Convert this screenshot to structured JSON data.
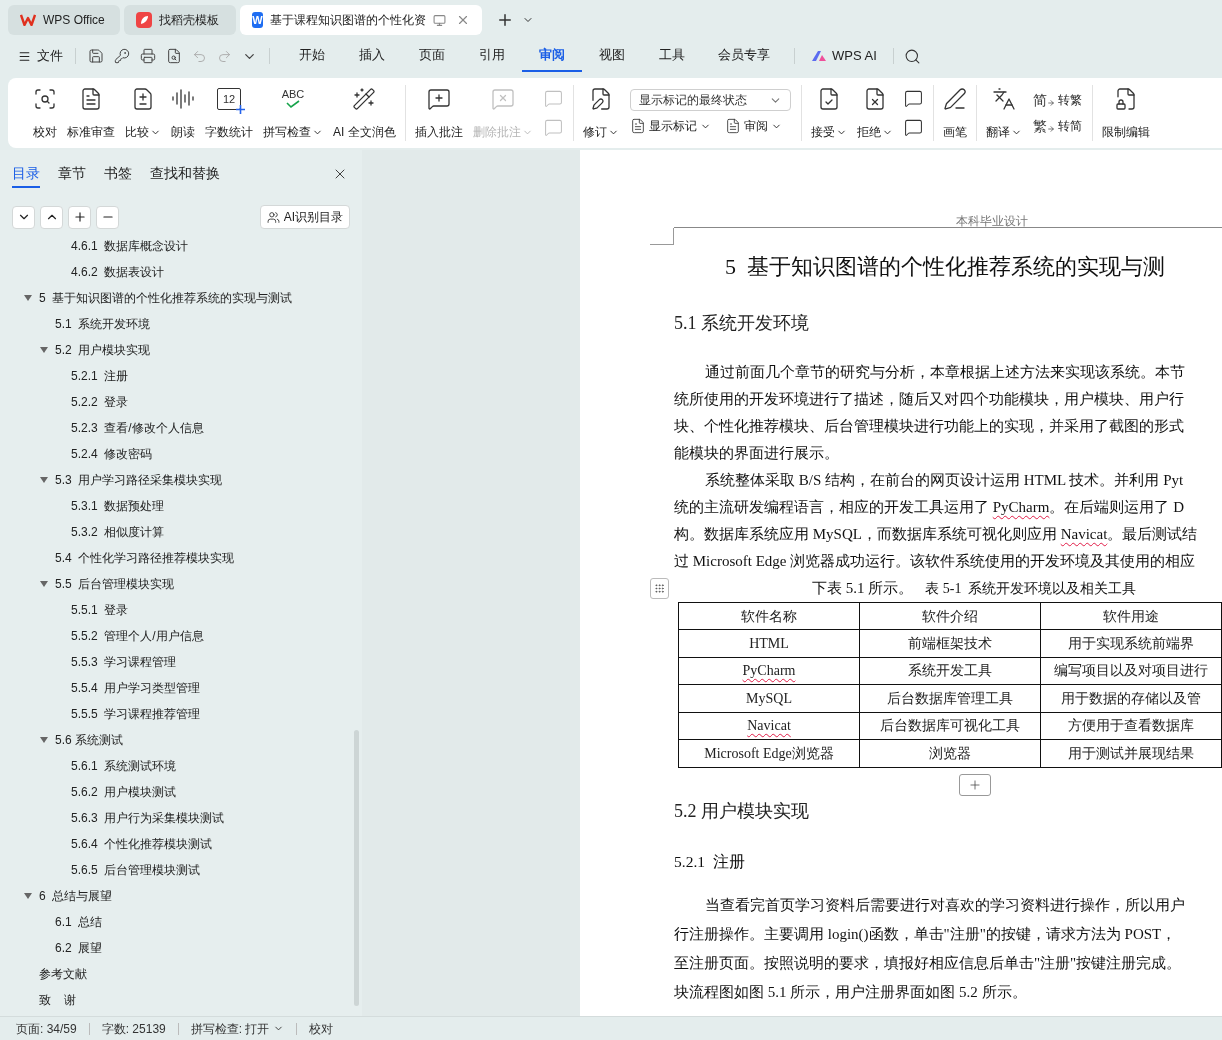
{
  "tabs": [
    {
      "label": "WPS Office",
      "selected": false
    },
    {
      "label": "找稻壳模板",
      "selected": false
    },
    {
      "label": "基于课程知识图谱的个性化资",
      "selected": true,
      "icon_letter": "W"
    }
  ],
  "menu": {
    "file": "文件",
    "tabs": [
      {
        "label": "开始",
        "selected": false
      },
      {
        "label": "插入",
        "selected": false
      },
      {
        "label": "页面",
        "selected": false
      },
      {
        "label": "引用",
        "selected": false
      },
      {
        "label": "审阅",
        "selected": true
      },
      {
        "label": "视图",
        "selected": false
      },
      {
        "label": "工具",
        "selected": false
      },
      {
        "label": "会员专享",
        "selected": false
      }
    ],
    "ai": "WPS AI"
  },
  "ribbon": {
    "groups": [
      {
        "items": [
          {
            "kind": "large",
            "label": "校对",
            "dropdown": false,
            "disabled": false
          },
          {
            "kind": "large",
            "label": "标准审查",
            "dropdown": false,
            "disabled": false
          },
          {
            "kind": "large",
            "label": "比较",
            "dropdown": true,
            "disabled": false
          },
          {
            "kind": "large",
            "label": "朗读",
            "dropdown": false,
            "disabled": false
          },
          {
            "kind": "large",
            "label": "字数统计",
            "dropdown": false,
            "disabled": false,
            "glyph": "12"
          },
          {
            "kind": "large",
            "label": "拼写检查",
            "dropdown": true,
            "disabled": false,
            "glyph": "ABC"
          },
          {
            "kind": "large",
            "label": "AI 全文润色",
            "dropdown": false,
            "disabled": false
          }
        ]
      },
      {
        "items": [
          {
            "kind": "large",
            "label": "插入批注",
            "dropdown": false,
            "disabled": false
          },
          {
            "kind": "large",
            "label": "删除批注",
            "dropdown": true,
            "disabled": true
          },
          {
            "kind": "stack",
            "rows": [
              [
                {
                  "kind": "icon",
                  "disabled": true
                }
              ],
              [
                {
                  "kind": "icon",
                  "disabled": true
                }
              ]
            ]
          }
        ]
      },
      {
        "items": [
          {
            "kind": "large",
            "label": "修订",
            "dropdown": true,
            "disabled": false
          },
          {
            "kind": "stack",
            "rows": [
              [
                {
                  "kind": "select",
                  "value": "显示标记的最终状态"
                }
              ],
              [
                {
                  "kind": "small",
                  "label": "显示标记",
                  "dropdown": true
                },
                {
                  "kind": "small",
                  "label": "审阅",
                  "dropdown": true
                }
              ]
            ]
          }
        ]
      },
      {
        "items": [
          {
            "kind": "large",
            "label": "接受",
            "dropdown": true,
            "disabled": false
          },
          {
            "kind": "large",
            "label": "拒绝",
            "dropdown": true,
            "disabled": false
          },
          {
            "kind": "stack",
            "rows": [
              [
                {
                  "kind": "icon",
                  "disabled": false
                }
              ],
              [
                {
                  "kind": "icon",
                  "disabled": false
                }
              ]
            ]
          }
        ]
      },
      {
        "items": [
          {
            "kind": "large",
            "label": "画笔",
            "dropdown": false,
            "disabled": false
          }
        ]
      },
      {
        "items": [
          {
            "kind": "large",
            "label": "翻译",
            "dropdown": true,
            "disabled": false
          },
          {
            "kind": "stack",
            "rows": [
              [
                {
                  "kind": "small",
                  "label": "转繁",
                  "dropdown": false,
                  "glyph": "简"
                }
              ],
              [
                {
                  "kind": "small",
                  "label": "转简",
                  "dropdown": false,
                  "glyph": "繁"
                }
              ]
            ]
          }
        ]
      },
      {
        "items": [
          {
            "kind": "large",
            "label": "限制编辑",
            "dropdown": false,
            "disabled": false
          }
        ]
      }
    ]
  },
  "sidebar": {
    "tabs": [
      {
        "label": "目录",
        "selected": true
      },
      {
        "label": "章节",
        "selected": false
      },
      {
        "label": "书签",
        "selected": false
      },
      {
        "label": "查找和替换",
        "selected": false
      }
    ],
    "ai_button": "AI识别目录",
    "partial_items": [
      {
        "label": "4.6.1  数据库概念设计"
      },
      {
        "label": "4.6.2  数据表设计"
      }
    ],
    "toc": [
      {
        "label": "5  基于知识图谱的个性化推荐系统的实现与测试",
        "expanded": true,
        "children": [
          {
            "label": "5.1  系统开发环境"
          },
          {
            "label": "5.2  用户模块实现",
            "expanded": true,
            "children": [
              {
                "label": "5.2.1  注册"
              },
              {
                "label": "5.2.2  登录"
              },
              {
                "label": "5.2.3  查看/修改个人信息"
              },
              {
                "label": "5.2.4  修改密码"
              }
            ]
          },
          {
            "label": "5.3  用户学习路径采集模块实现",
            "expanded": true,
            "children": [
              {
                "label": "5.3.1  数据预处理"
              },
              {
                "label": "5.3.2  相似度计算"
              }
            ]
          },
          {
            "label": "5.4  个性化学习路径推荐模块实现"
          },
          {
            "label": "5.5  后台管理模块实现",
            "expanded": true,
            "children": [
              {
                "label": "5.5.1  登录"
              },
              {
                "label": "5.5.2  管理个人/用户信息"
              },
              {
                "label": "5.5.3  学习课程管理"
              },
              {
                "label": "5.5.4  用户学习类型管理"
              },
              {
                "label": "5.5.5  学习课程推荐管理"
              }
            ]
          },
          {
            "label": "5.6 系统测试",
            "expanded": true,
            "children": [
              {
                "label": "5.6.1  系统测试环境"
              },
              {
                "label": "5.6.2  用户模块测试"
              },
              {
                "label": "5.6.3  用户行为采集模块测试"
              },
              {
                "label": "5.6.4  个性化推荐模块测试"
              },
              {
                "label": "5.6.5  后台管理模块测试"
              }
            ]
          }
        ]
      },
      {
        "label": "6  总结与展望",
        "expanded": true,
        "children": [
          {
            "label": "6.1  总结"
          },
          {
            "label": "6.2  展望"
          }
        ]
      },
      {
        "label": "参考文献"
      },
      {
        "label": "致    谢"
      }
    ]
  },
  "document": {
    "header": "本科毕业设计",
    "title": "5  基于知识图谱的个性化推荐系统的实现与测",
    "blocks": [
      {
        "kind": "heading2",
        "text": "5.1  系统开发环境"
      },
      {
        "kind": "paragraph",
        "lines": [
          "通过前面几个章节的研究与分析，本章根据上述方法来实现该系统。本节",
          "统所使用的开发环境进行了描述，随后又对四个功能模块，用户模块、用户行",
          "块、个性化推荐模块、后台管理模块进行功能上的实现，并采用了截图的形式",
          "能模块的界面进行展示。"
        ]
      },
      {
        "kind": "paragraph",
        "lines": [
          "系统整体采取 B/S 结构，在前台的网页设计运用 HTML 技术。并利用 Pyt",
          [
            {
              "text": "统的主流研发编程语言，相应的开发工具运用了 ",
              "misspelled": false
            },
            {
              "text": "PyCharm",
              "misspelled": true
            },
            {
              "text": "。在后端则运用了 D",
              "misspelled": false
            }
          ],
          [
            {
              "text": "构。数据库系统应用 MySQL，而数据库系统可视化则应用 ",
              "misspelled": false
            },
            {
              "text": "Navicat",
              "misspelled": true
            },
            {
              "text": "。最后测试结",
              "misspelled": false
            }
          ],
          "过 Microsoft Edge 浏览器成功运行。该软件系统使用的开发环境及其使用的相应"
        ]
      },
      {
        "kind": "caption_line",
        "text": "下表 5.1 所示。",
        "caption": "表 5-1  系统开发环境以及相关工具"
      },
      {
        "kind": "table",
        "columns": [
          "软件名称",
          "软件介绍",
          "软件用途"
        ],
        "rows": [
          [
            "HTML",
            "前端框架技术",
            "用于实现系统前端界"
          ],
          [
            {
              "text": "PyCharm",
              "misspelled": true
            },
            "系统开发工具",
            "编写项目以及对项目进行"
          ],
          [
            "MySQL",
            "后台数据库管理工具",
            "用于数据的存储以及管"
          ],
          [
            {
              "text": "Navicat",
              "misspelled": true
            },
            "后台数据库可视化工具",
            "方便用于查看数据库"
          ],
          [
            "Microsoft Edge浏览器",
            "浏览器",
            "用于测试并展现结果"
          ]
        ]
      },
      {
        "kind": "heading2",
        "text": "5.2  用户模块实现"
      },
      {
        "kind": "heading3",
        "text": "5.2.1  注册"
      },
      {
        "kind": "paragraph",
        "lines": [
          "当查看完首页学习资料后需要进行对喜欢的学习资料进行操作，所以用户",
          "行注册操作。主要调用 login()函数，单击\"注册\"的按键，请求方法为 POST，",
          "至注册页面。按照说明的要求，填报好相应信息后单击\"注册\"按键注册完成。",
          "块流程图如图 5.1 所示，用户注册界面如图 5.2 所示。"
        ]
      }
    ]
  },
  "status_bar": [
    {
      "text": "页面: 34/59",
      "dropdown": false
    },
    {
      "text": "字数: 25139",
      "dropdown": false
    },
    {
      "text": "拼写检查: 打开",
      "dropdown": true
    },
    {
      "text": "校对",
      "dropdown": false
    }
  ]
}
